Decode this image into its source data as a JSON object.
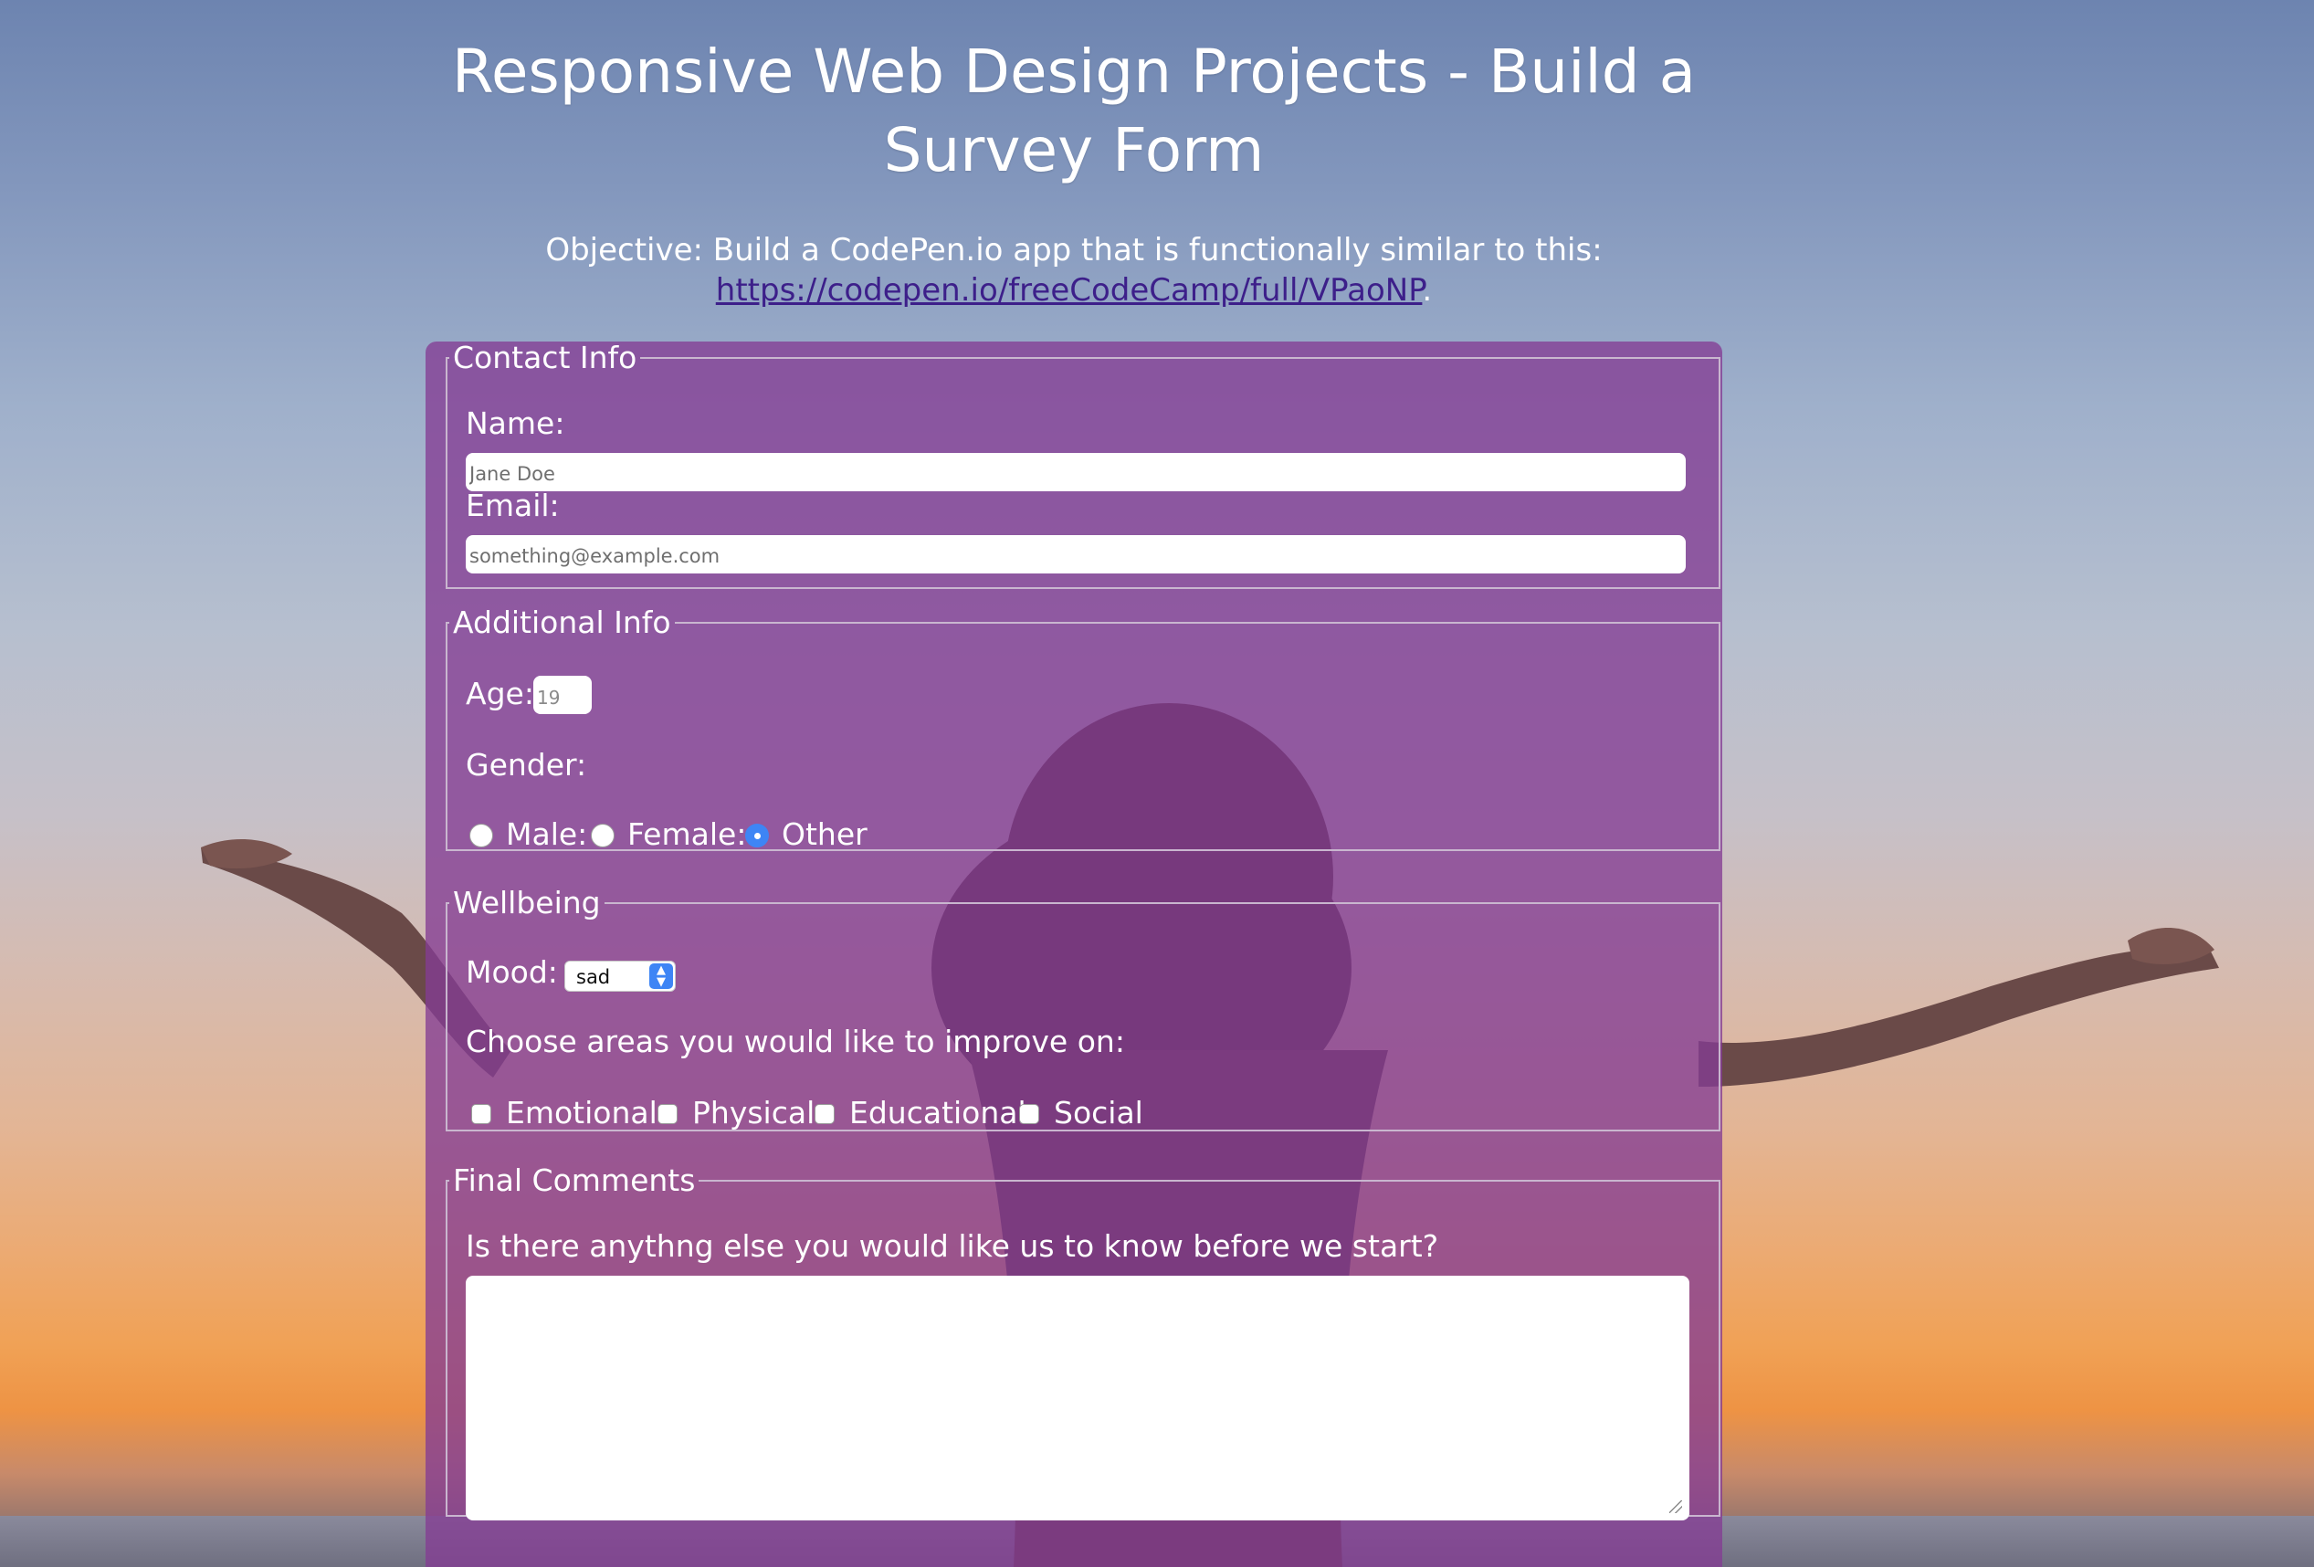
{
  "header": {
    "title": "Responsive Web Design Projects - Build a Survey Form",
    "objective_text": "Objective: Build a CodePen.io app that is functionally similar to this:",
    "objective_link": "https://codepen.io/freeCodeCamp/full/VPaoNP",
    "objective_period": "."
  },
  "contact": {
    "legend": "Contact Info",
    "name_label": "Name:",
    "name_placeholder": "Jane Doe",
    "email_label": "Email:",
    "email_placeholder": "something@example.com"
  },
  "additional": {
    "legend": "Additional Info",
    "age_label": "Age:",
    "age_placeholder": "19",
    "gender_label": "Gender:",
    "genders": [
      {
        "label": "Male:",
        "checked": false
      },
      {
        "label": "Female:",
        "checked": false
      },
      {
        "label": "Other",
        "checked": true
      }
    ]
  },
  "wellbeing": {
    "legend": "Wellbeing",
    "mood_label": "Mood:",
    "mood_value": "sad",
    "improve_label": "Choose areas you would like to improve on:",
    "areas": [
      {
        "label": "Emotional",
        "checked": false
      },
      {
        "label": "Physical",
        "checked": false
      },
      {
        "label": "Educational",
        "checked": false
      },
      {
        "label": "Social",
        "checked": false
      }
    ]
  },
  "final": {
    "legend": "Final Comments",
    "question": "Is there anythng else you would like us to know before we start?",
    "comments_value": ""
  },
  "colors": {
    "panel": "#843c94",
    "accent": "#3e85f5",
    "link": "#3d1f8a"
  }
}
